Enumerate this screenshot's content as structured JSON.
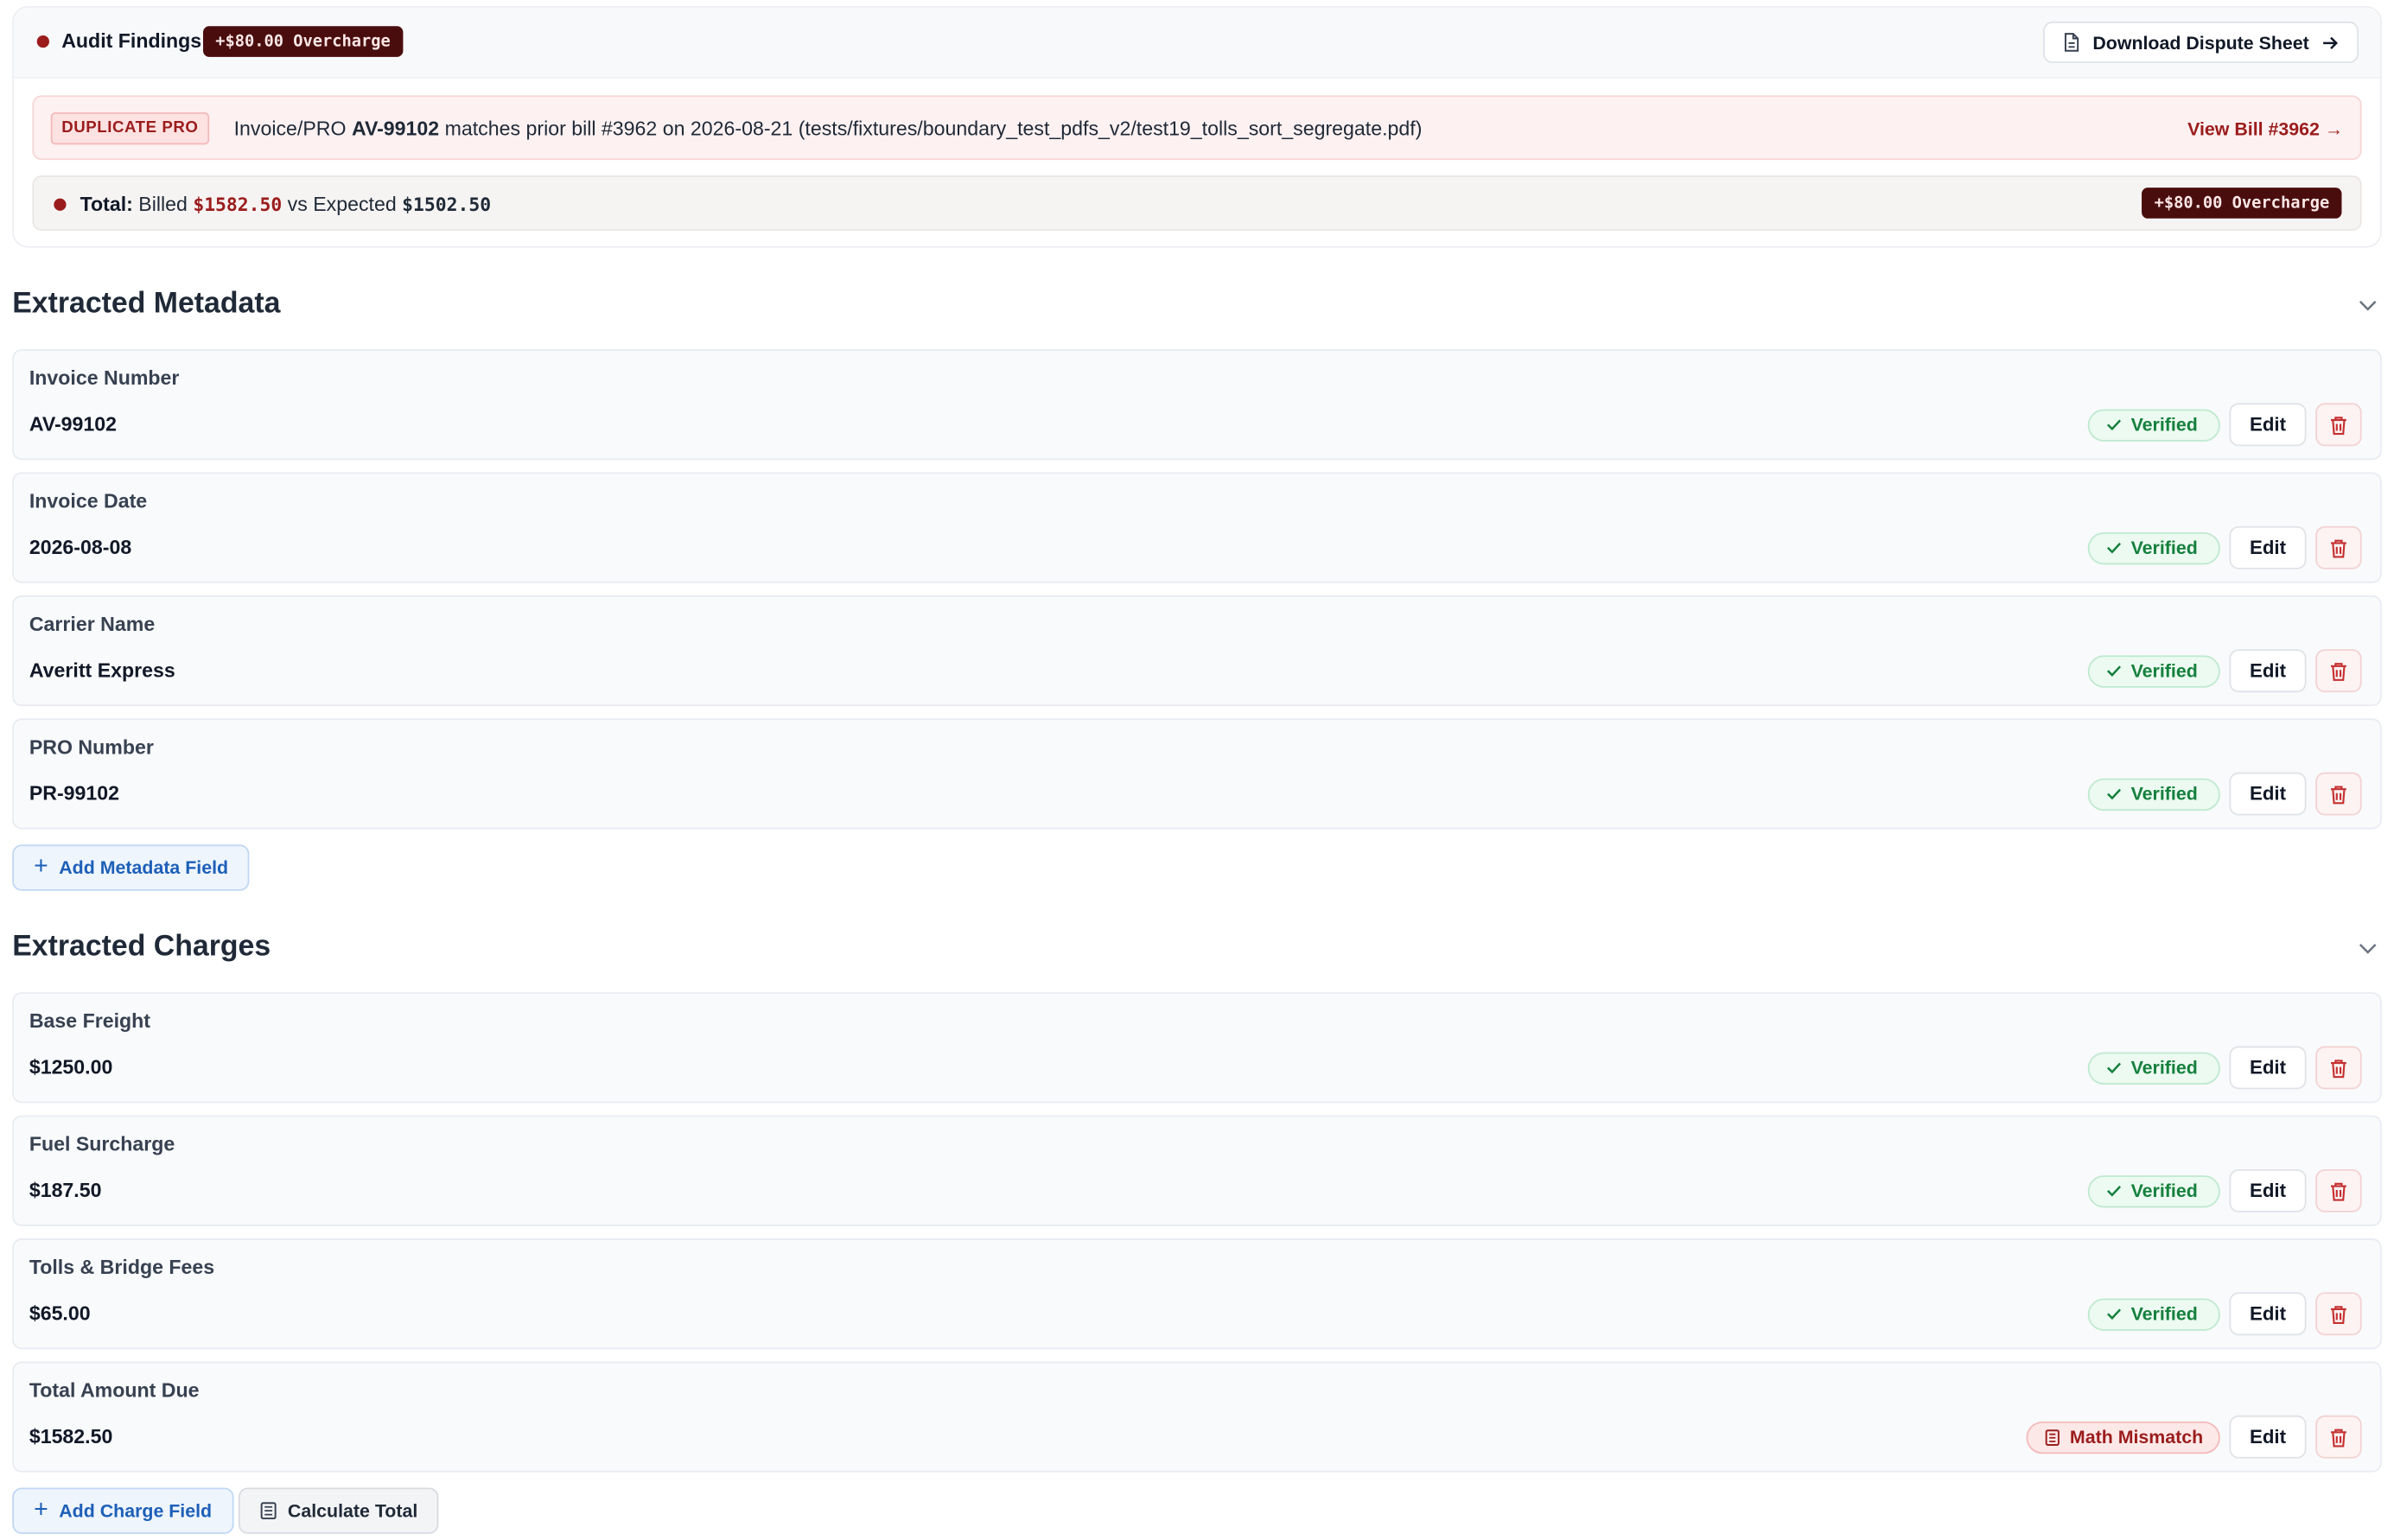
{
  "audit": {
    "title": "Audit Findings",
    "header_badge": "+$80.00 Overcharge",
    "download_label": "Download Dispute Sheet",
    "duplicate": {
      "tag": "DUPLICATE PRO",
      "text_prefix": "Invoice/PRO ",
      "pro": "AV-99102",
      "text_suffix": " matches prior bill #3962 on 2026-08-21 (tests/fixtures/boundary_test_pdfs_v2/test19_tolls_sort_segregate.pdf)",
      "link": "View Bill #3962"
    },
    "total": {
      "label": "Total:",
      "billed_text": " Billed ",
      "billed": "$1582.50",
      "vs_text": " vs Expected ",
      "expected": "$1502.50",
      "badge": "+$80.00 Overcharge"
    },
    "colors": {
      "accent_dark": "#4a0d0d",
      "danger": "#9b1c1c"
    }
  },
  "metadata": {
    "title": "Extracted Metadata",
    "fields": [
      {
        "label": "Invoice Number",
        "value": "AV-99102",
        "status": "Verified"
      },
      {
        "label": "Invoice Date",
        "value": "2026-08-08",
        "status": "Verified"
      },
      {
        "label": "Carrier Name",
        "value": "Averitt Express",
        "status": "Verified"
      },
      {
        "label": "PRO Number",
        "value": "PR-99102",
        "status": "Verified"
      }
    ],
    "add_label": "Add Metadata Field"
  },
  "charges": {
    "title": "Extracted Charges",
    "fields": [
      {
        "label": "Base Freight",
        "value": "$1250.00",
        "status": "Verified"
      },
      {
        "label": "Fuel Surcharge",
        "value": "$187.50",
        "status": "Verified"
      },
      {
        "label": "Tolls & Bridge Fees",
        "value": "$65.00",
        "status": "Verified"
      },
      {
        "label": "Total Amount Due",
        "value": "$1582.50",
        "status": "Math Mismatch"
      }
    ],
    "add_label": "Add Charge Field",
    "calc_label": "Calculate Total"
  },
  "common": {
    "edit_label": "Edit"
  },
  "icons": {
    "file": "file-icon",
    "arrow": "arrow-right-icon",
    "check": "check-icon",
    "trash": "trash-icon",
    "chevron": "chevron-down-icon",
    "plus": "plus-icon",
    "calculator": "calculator-icon"
  }
}
